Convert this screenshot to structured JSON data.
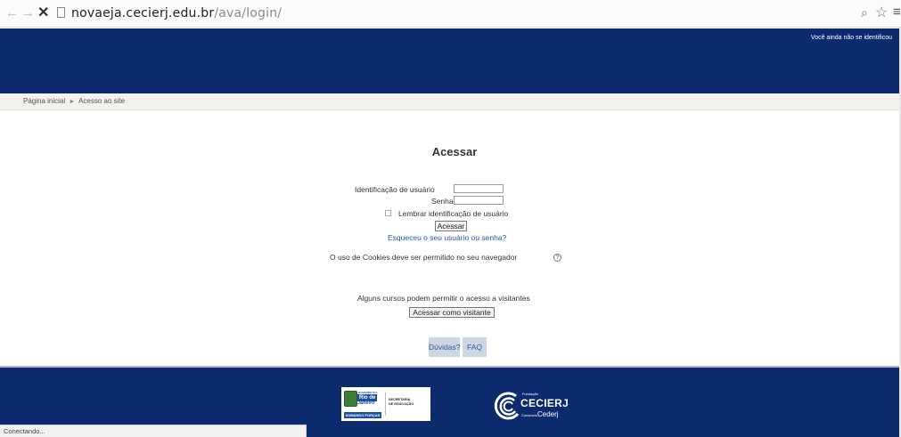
{
  "browser": {
    "back_icon": "←",
    "forward_icon": "→",
    "stop_icon": "✕",
    "url_host": "novaeja.cecierj.edu.br",
    "url_path": "/ava/login/",
    "zoom_icon": "⌕",
    "star_icon": "☆",
    "menu_icon": "≡",
    "status_text": "Conectando..."
  },
  "header": {
    "login_info": "Você ainda não se identificou",
    "color": "#0b2b6e"
  },
  "breadcrumb": {
    "items": [
      "Página inicial",
      "Acesso ao site"
    ],
    "separator": "►"
  },
  "login": {
    "title": "Acessar",
    "username_label": "Identificação de usuário",
    "username_value": "",
    "password_label": "Senha",
    "password_value": "",
    "remember_label": "Lembrar identificação de usuário",
    "remember_checked": false,
    "submit_label": "Acessar",
    "forgot_link": "Esqueceu o seu usuário ou senha?",
    "cookies_notice": "O uso de Cookies deve ser permitido no seu navegador",
    "help_icon": "?",
    "guest_notice": "Alguns cursos podem permitir o acesso a visitantes",
    "guest_button": "Acessar como visitante"
  },
  "footer_links": {
    "help": "Dúvidas?",
    "faq": "FAQ"
  },
  "footer": {
    "logo_rj": {
      "gov": "GOVERNO DO",
      "rio": "Rio de",
      "janeiro": "Janeiro",
      "slogan": "SOMANDO FORÇAS",
      "secretaria_1": "SECRETARIA",
      "secretaria_2": "DE EDUCAÇÃO"
    },
    "logo_cecierj": {
      "fundacao": "Fundação",
      "name": "CECIERJ",
      "consorcio": "Consórcio",
      "cederj": "Cederj"
    }
  }
}
